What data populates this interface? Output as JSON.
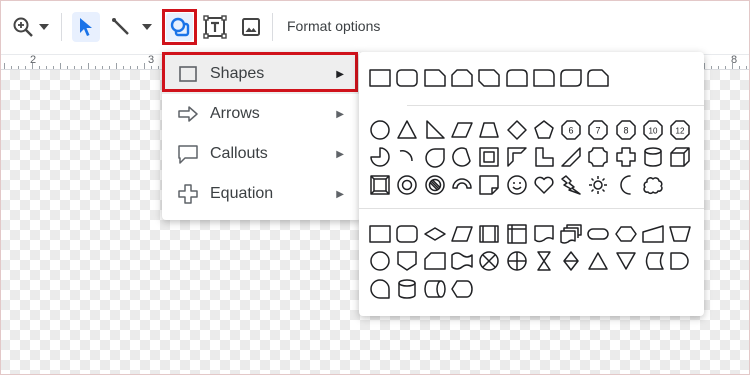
{
  "toolbar": {
    "format_options_label": "Format options"
  },
  "ruler": {
    "labels": [
      "2",
      "3",
      "8"
    ]
  },
  "menu": {
    "items": [
      {
        "label": "Shapes",
        "icon": "square-icon"
      },
      {
        "label": "Arrows",
        "icon": "arrow-right-icon"
      },
      {
        "label": "Callouts",
        "icon": "callout-icon"
      },
      {
        "label": "Equation",
        "icon": "plus-icon"
      }
    ]
  },
  "shape_badges": {
    "hexagon": "6",
    "heptagon": "7",
    "octagon": "8",
    "decagon": "10",
    "dodecagon": "12"
  },
  "colors": {
    "accent": "#1a73e8",
    "highlight": "#d0121b",
    "icon_gray": "#5f6368"
  }
}
